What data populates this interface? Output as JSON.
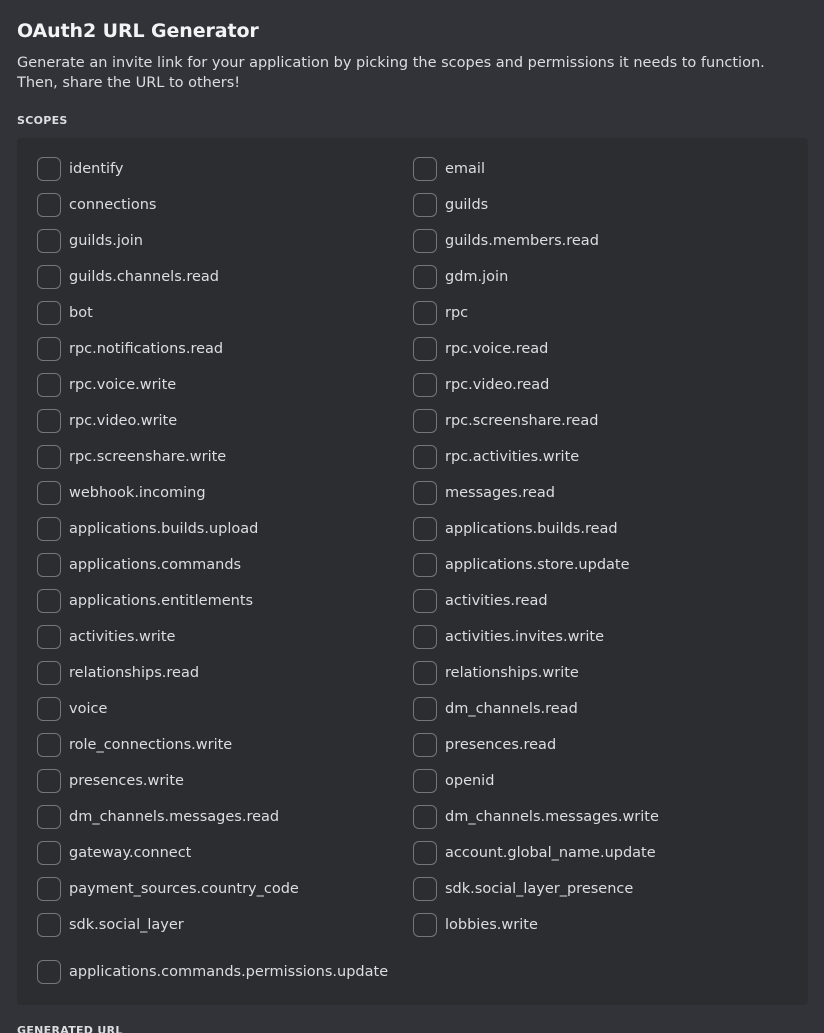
{
  "title": "OAuth2 URL Generator",
  "description": "Generate an invite link for your application by picking the scopes and permissions it needs to function. Then, share the URL to others!",
  "scopes_label": "SCOPES",
  "next_section_label": "GENERATED URL",
  "scopes": {
    "left": [
      {
        "name": "identify",
        "checked": false
      },
      {
        "name": "connections",
        "checked": false
      },
      {
        "name": "guilds.join",
        "checked": false
      },
      {
        "name": "guilds.channels.read",
        "checked": false
      },
      {
        "name": "bot",
        "checked": false
      },
      {
        "name": "rpc.notifications.read",
        "checked": false
      },
      {
        "name": "rpc.voice.write",
        "checked": false
      },
      {
        "name": "rpc.video.write",
        "checked": false
      },
      {
        "name": "rpc.screenshare.write",
        "checked": false
      },
      {
        "name": "webhook.incoming",
        "checked": false
      },
      {
        "name": "applications.builds.upload",
        "checked": false
      },
      {
        "name": "applications.commands",
        "checked": false
      },
      {
        "name": "applications.entitlements",
        "checked": false
      },
      {
        "name": "activities.write",
        "checked": false
      },
      {
        "name": "relationships.read",
        "checked": false
      },
      {
        "name": "voice",
        "checked": false
      },
      {
        "name": "role_connections.write",
        "checked": false
      },
      {
        "name": "presences.write",
        "checked": false
      },
      {
        "name": "dm_channels.messages.read",
        "checked": false
      },
      {
        "name": "gateway.connect",
        "checked": false
      },
      {
        "name": "payment_sources.country_code",
        "checked": false
      },
      {
        "name": "sdk.social_layer",
        "checked": false
      }
    ],
    "right": [
      {
        "name": "email",
        "checked": false
      },
      {
        "name": "guilds",
        "checked": false
      },
      {
        "name": "guilds.members.read",
        "checked": false
      },
      {
        "name": "gdm.join",
        "checked": false
      },
      {
        "name": "rpc",
        "checked": false
      },
      {
        "name": "rpc.voice.read",
        "checked": false
      },
      {
        "name": "rpc.video.read",
        "checked": false
      },
      {
        "name": "rpc.screenshare.read",
        "checked": false
      },
      {
        "name": "rpc.activities.write",
        "checked": false
      },
      {
        "name": "messages.read",
        "checked": false
      },
      {
        "name": "applications.builds.read",
        "checked": false
      },
      {
        "name": "applications.store.update",
        "checked": false
      },
      {
        "name": "activities.read",
        "checked": false
      },
      {
        "name": "activities.invites.write",
        "checked": false
      },
      {
        "name": "relationships.write",
        "checked": false
      },
      {
        "name": "dm_channels.read",
        "checked": false
      },
      {
        "name": "presences.read",
        "checked": false
      },
      {
        "name": "openid",
        "checked": false
      },
      {
        "name": "dm_channels.messages.write",
        "checked": false
      },
      {
        "name": "account.global_name.update",
        "checked": false
      },
      {
        "name": "sdk.social_layer_presence",
        "checked": false
      },
      {
        "name": "lobbies.write",
        "checked": false
      }
    ],
    "footer": [
      {
        "name": "applications.commands.permissions.update",
        "checked": false
      }
    ]
  }
}
